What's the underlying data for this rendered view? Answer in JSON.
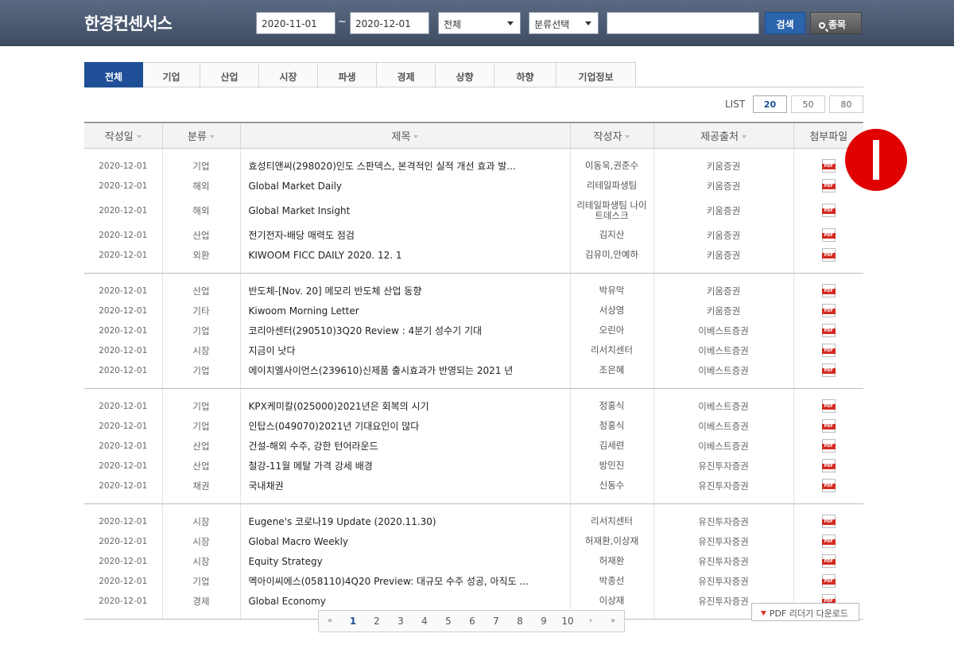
{
  "header": {
    "logo": "한경컨센서스",
    "date_from": "2020-11-01",
    "date_to": "2020-12-01",
    "tilde": "~",
    "select_all": "전체",
    "select_category": "분류선택",
    "search_label": "검색",
    "stock_label": "종목"
  },
  "tabs": [
    "전체",
    "기업",
    "산업",
    "시장",
    "파생",
    "경제",
    "상향",
    "하향",
    "기업정보"
  ],
  "list": {
    "label": "LIST",
    "options": [
      "20",
      "50",
      "80"
    ]
  },
  "columns": [
    "작성일",
    "분류",
    "제목",
    "작성자",
    "제공출처",
    "첨부파일"
  ],
  "rows": [
    [
      "2020-12-01",
      "기업",
      "효성티앤씨(298020)인도 스판덱스, 본격적인 실적 개선 효과 발...",
      "이동욱,권준수",
      "키움증권"
    ],
    [
      "2020-12-01",
      "해외",
      "Global Market Daily",
      "리테일파생팀",
      "키움증권"
    ],
    [
      "2020-12-01",
      "해외",
      "Global Market Insight",
      "리테일파생팀 나이트데스크",
      "키움증권"
    ],
    [
      "2020-12-01",
      "산업",
      "전기전자-배당 매력도 점검",
      "김지산",
      "키움증권"
    ],
    [
      "2020-12-01",
      "외환",
      "KIWOOM FICC DAILY 2020. 12. 1",
      "김유미,안예하",
      "키움증권"
    ],
    [
      "2020-12-01",
      "산업",
      "반도체-[Nov. 20] 메모리 반도체 산업 동향",
      "박유악",
      "키움증권"
    ],
    [
      "2020-12-01",
      "기타",
      "Kiwoom Morning Letter",
      "서상영",
      "키움증권"
    ],
    [
      "2020-12-01",
      "기업",
      "코리아센터(290510)3Q20 Review : 4분기 성수기 기대",
      "오린아",
      "이베스트증권"
    ],
    [
      "2020-12-01",
      "시장",
      "지금이 낫다",
      "리서치센터",
      "이베스트증권"
    ],
    [
      "2020-12-01",
      "기업",
      "에이치엘사이언스(239610)신제품 출시효과가 반영되는 2021 년",
      "조은혜",
      "이베스트증권"
    ],
    [
      "2020-12-01",
      "기업",
      "KPX케미칼(025000)2021년은 회복의 시기",
      "정홍식",
      "이베스트증권"
    ],
    [
      "2020-12-01",
      "기업",
      "인탑스(049070)2021년 기대요인이 많다",
      "정홍식",
      "이베스트증권"
    ],
    [
      "2020-12-01",
      "산업",
      "건설-해외 수주, 강한 턴어라운드",
      "김세련",
      "이베스트증권"
    ],
    [
      "2020-12-01",
      "산업",
      "철강-11월 메탈 가격 강세 배경",
      "방민진",
      "유진투자증권"
    ],
    [
      "2020-12-01",
      "채권",
      "국내채권",
      "신동수",
      "유진투자증권"
    ],
    [
      "2020-12-01",
      "시장",
      "Eugene's 코로나19 Update (2020.11.30)",
      "리서치센터",
      "유진투자증권"
    ],
    [
      "2020-12-01",
      "시장",
      "Global Macro Weekly",
      "허재환,이상재",
      "유진투자증권"
    ],
    [
      "2020-12-01",
      "시장",
      "Equity Strategy",
      "허재환",
      "유진투자증권"
    ],
    [
      "2020-12-01",
      "기업",
      "멕아이씨에스(058110)4Q20 Preview: 대규모 수주 성공, 아직도 ...",
      "박종선",
      "유진투자증권"
    ],
    [
      "2020-12-01",
      "경제",
      "Global Economy",
      "이상재",
      "유진투자증권"
    ]
  ],
  "pagination": {
    "first": "«",
    "prev": "‹",
    "next": "›",
    "last": "»",
    "pages": [
      "1",
      "2",
      "3",
      "4",
      "5",
      "6",
      "7",
      "8",
      "9",
      "10"
    ],
    "current": "1"
  },
  "pdf_reader": "PDF 리더기 다운로드",
  "colors": {
    "header_bg": "#4a586e",
    "active_tab": "#1f4f96",
    "search_btn": "#2a64ad",
    "pdf_red": "#d42b22",
    "marker_red": "#e00000"
  }
}
